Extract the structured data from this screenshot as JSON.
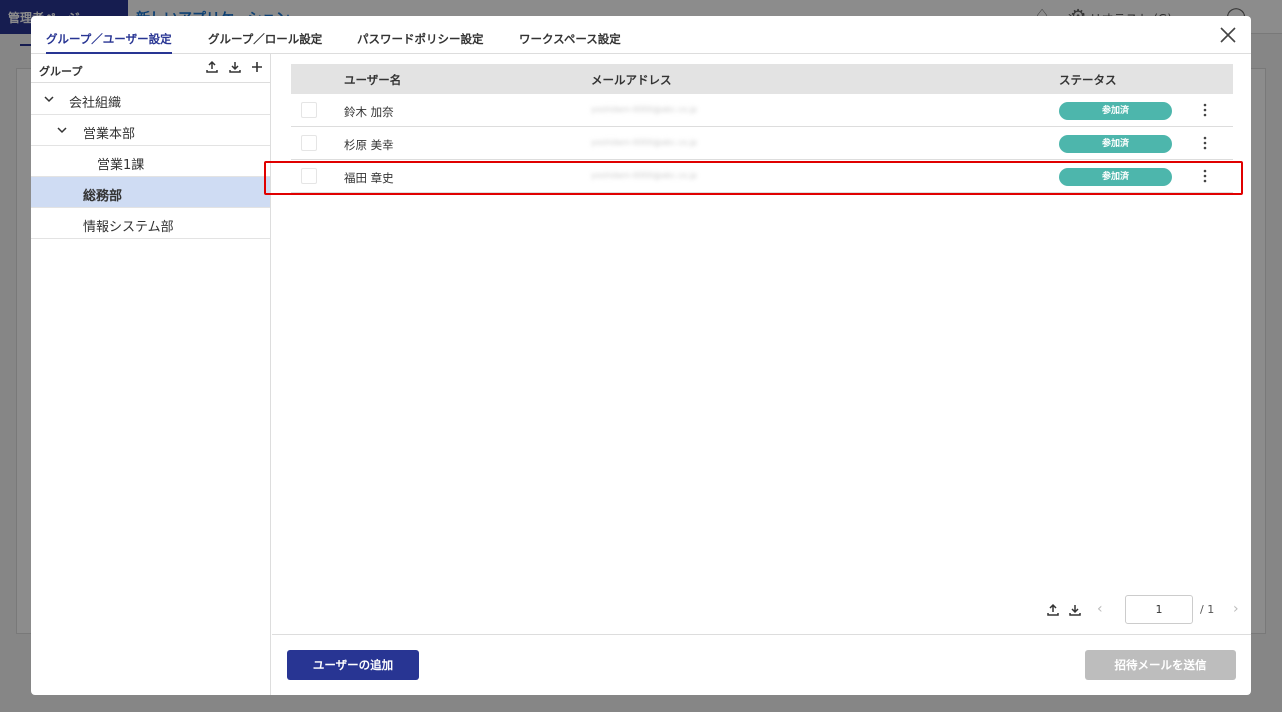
{
  "background": {
    "admin_label": "管理者ページ",
    "app_title": "新しいアプリケーション",
    "user_label": "シナリオテスト (G)"
  },
  "modal": {
    "tabs": [
      {
        "label": "グループ／ユーザー設定",
        "active": true
      },
      {
        "label": "グループ／ロール設定",
        "active": false
      },
      {
        "label": "パスワードポリシー設定",
        "active": false
      },
      {
        "label": "ワークスペース設定",
        "active": false
      }
    ]
  },
  "group_panel": {
    "header": "グループ",
    "tree": [
      {
        "label": "会社組織",
        "expanded": true,
        "selected": false
      },
      {
        "label": "営業本部",
        "expanded": true,
        "selected": false
      },
      {
        "label": "営業1課",
        "expanded": false,
        "selected": false
      },
      {
        "label": "総務部",
        "expanded": false,
        "selected": true
      },
      {
        "label": "情報システム部",
        "expanded": false,
        "selected": false
      }
    ]
  },
  "user_table": {
    "columns": [
      "ユーザー名",
      "メールアドレス",
      "ステータス"
    ],
    "rows": [
      {
        "name": "鈴木 加奈",
        "email": "yoshidam-0000@abc.co.jp",
        "status": "参加済"
      },
      {
        "name": "杉原 美幸",
        "email": "yoshidam-0000@abc.co.jp",
        "status": "参加済"
      },
      {
        "name": "福田 章史",
        "email": "yoshidam-0000@abc.co.jp",
        "status": "参加済"
      }
    ]
  },
  "pagination": {
    "current_page": "1",
    "total": "/ 1"
  },
  "footer": {
    "add_user_label": "ユーザーの追加",
    "send_invite_label": "招待メールを送信"
  },
  "colors": {
    "primary": "#283593",
    "status_badge": "#4db6ac",
    "selected_row": "#cfdcf3",
    "highlight": "#e00000"
  }
}
